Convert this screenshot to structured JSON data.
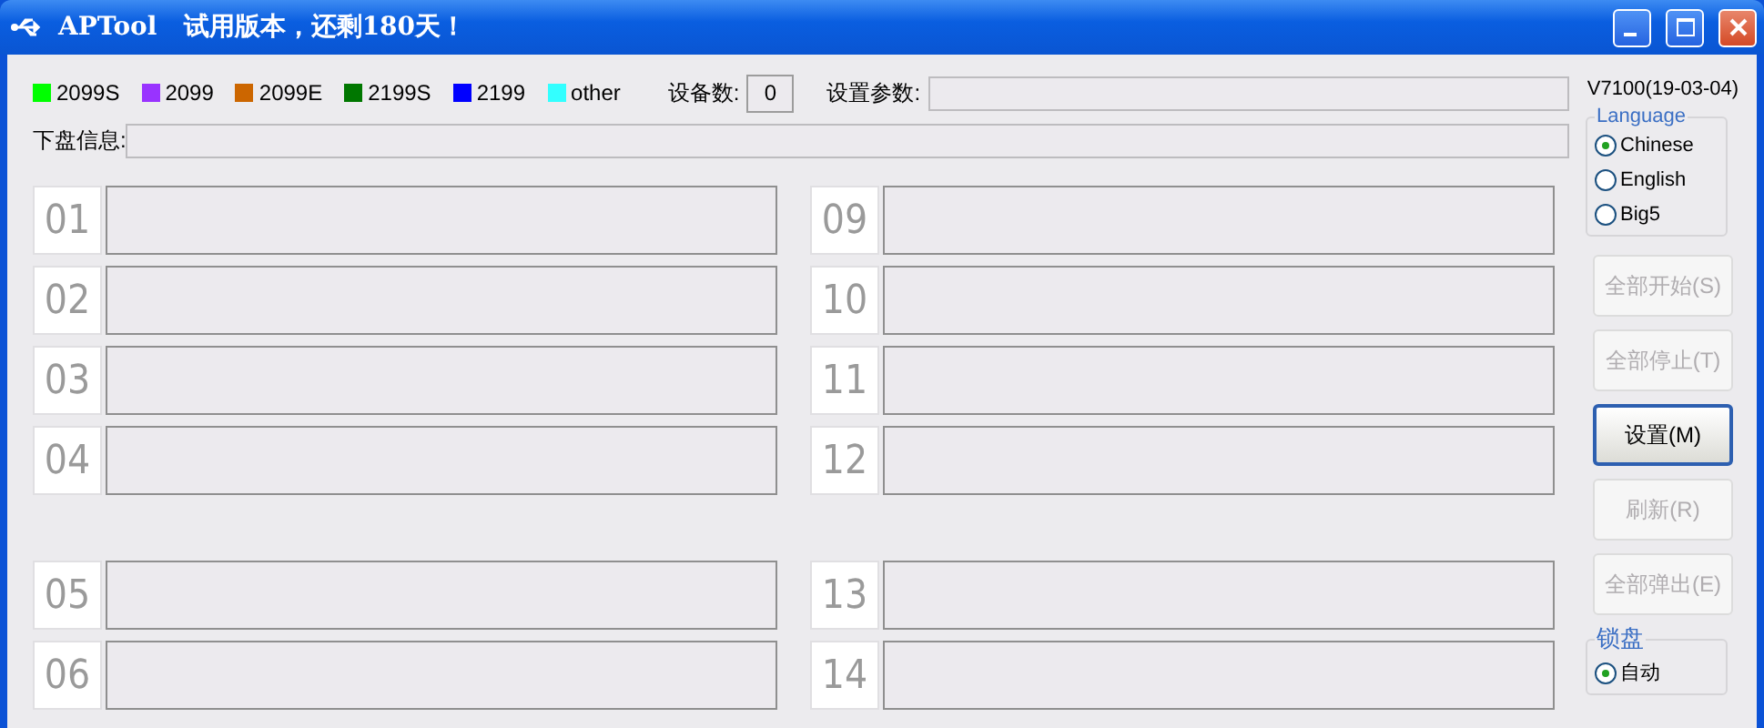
{
  "window": {
    "title": "APTool   试用版本，还剩180天！"
  },
  "legend": [
    {
      "label": "2099S",
      "color": "#00ff00"
    },
    {
      "label": "2099",
      "color": "#9933ff"
    },
    {
      "label": "2099E",
      "color": "#cc6600"
    },
    {
      "label": "2199S",
      "color": "#007700"
    },
    {
      "label": "2199",
      "color": "#0000ff"
    },
    {
      "label": "other",
      "color": "#33ffff"
    }
  ],
  "device_count": {
    "label": "设备数:",
    "value": "0"
  },
  "settings_params": {
    "label": "设置参数:"
  },
  "version": "V7100(19-03-04)",
  "disk_info": {
    "label": "下盘信息:"
  },
  "slot_columns": [
    {
      "upper": [
        "01",
        "02",
        "03",
        "04"
      ],
      "lower": [
        "05",
        "06"
      ]
    },
    {
      "upper": [
        "09",
        "10",
        "11",
        "12"
      ],
      "lower": [
        "13",
        "14"
      ]
    }
  ],
  "language": {
    "title": "Language",
    "options": [
      {
        "label": "Chinese",
        "selected": true
      },
      {
        "label": "English",
        "selected": false
      },
      {
        "label": "Big5",
        "selected": false
      }
    ]
  },
  "buttons": [
    {
      "label": "全部开始(S)",
      "disabled": true
    },
    {
      "label": "全部停止(T)",
      "disabled": true
    },
    {
      "label": "设置(M)",
      "disabled": false
    },
    {
      "label": "刷新(R)",
      "disabled": true
    },
    {
      "label": "全部弹出(E)",
      "disabled": true
    }
  ],
  "lock": {
    "title": "锁盘",
    "options": [
      {
        "label": "自动",
        "selected": true
      }
    ]
  }
}
